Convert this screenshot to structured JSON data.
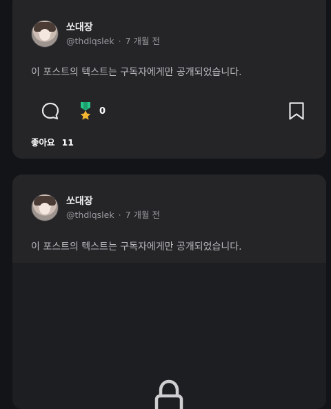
{
  "posts": [
    {
      "author_name": "쏘대장",
      "handle": "@thdlqslek",
      "separator": "·",
      "time": "7 개월 전",
      "body": "이 포스트의 텍스트는 구독자에게만 공개되었습니다.",
      "medal_count": "0",
      "likes_label": "좋아요",
      "likes_count": "11"
    },
    {
      "author_name": "쏘대장",
      "handle": "@thdlqslek",
      "separator": "·",
      "time": "7 개월 전",
      "body": "이 포스트의 텍스트는 구독자에게만 공개되었습니다."
    }
  ],
  "icons": {
    "comment": "comment-icon",
    "medal": "medal-icon",
    "bookmark": "bookmark-icon",
    "lock": "lock-icon"
  },
  "colors": {
    "background": "#131417",
    "card": "#252528",
    "medal_ribbon": "#27c58a",
    "medal_star": "#f2b431"
  }
}
